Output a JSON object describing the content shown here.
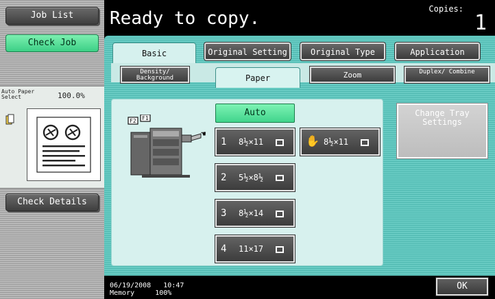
{
  "left_panel": {
    "job_list": "Job List",
    "check_job": "Check Job",
    "preview_label": "Auto Paper Select",
    "preview_zoom": "100.0%",
    "check_details": "Check Details"
  },
  "header": {
    "title": "Ready to copy.",
    "copies_label": "Copies:",
    "copies_value": "1"
  },
  "tabs": {
    "top": [
      "Basic",
      "Original Setting",
      "Original Type",
      "Application"
    ],
    "sub": [
      "Density/ Background",
      "Paper",
      "Zoom",
      "Duplex/ Combine"
    ]
  },
  "paper": {
    "auto": "Auto",
    "machine_labels": [
      "F2",
      "F1"
    ],
    "trays": [
      {
        "num": "1",
        "size": "8½×11"
      },
      {
        "num": "2",
        "size": "5½×8½"
      },
      {
        "num": "3",
        "size": "8½×14"
      },
      {
        "num": "4",
        "size": "11×17"
      }
    ],
    "bypass": {
      "size": "8½×11"
    },
    "change_tray": "Change Tray Settings"
  },
  "footer": {
    "date": "06/19/2008",
    "time": "10:47",
    "memory_label": "Memory",
    "memory_value": "100%",
    "ok": "OK"
  }
}
